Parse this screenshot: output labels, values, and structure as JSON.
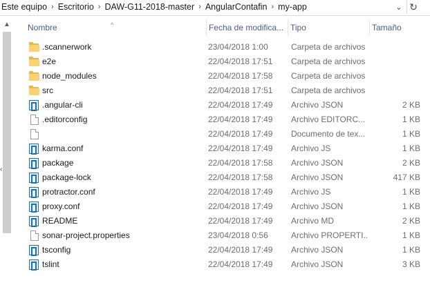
{
  "breadcrumb": [
    "Este equipo",
    "Escritorio",
    "DAW-G11-2018-master",
    "AngularContafin",
    "my-app"
  ],
  "columns": {
    "name": "Nombre",
    "date": "Fecha de modifica...",
    "type": "Tipo",
    "size": "Tamaño"
  },
  "files": [
    {
      "icon": "folder-icon",
      "name": ".scannerwork",
      "date": "23/04/2018 1:00",
      "type": "Carpeta de archivos",
      "size": ""
    },
    {
      "icon": "folder-icon",
      "name": "e2e",
      "date": "22/04/2018 17:51",
      "type": "Carpeta de archivos",
      "size": ""
    },
    {
      "icon": "folder-icon",
      "name": "node_modules",
      "date": "22/04/2018 17:58",
      "type": "Carpeta de archivos",
      "size": ""
    },
    {
      "icon": "folder-icon",
      "name": "src",
      "date": "22/04/2018 17:51",
      "type": "Carpeta de archivos",
      "size": ""
    },
    {
      "icon": "json-file-icon",
      "name": ".angular-cli",
      "date": "22/04/2018 17:49",
      "type": "Archivo JSON",
      "size": "2 KB"
    },
    {
      "icon": "blank-file-icon",
      "name": ".editorconfig",
      "date": "22/04/2018 17:49",
      "type": "Archivo EDITORC...",
      "size": "1 KB"
    },
    {
      "icon": "blank-file-icon",
      "name": "",
      "date": "22/04/2018 17:49",
      "type": "Documento de tex...",
      "size": "1 KB"
    },
    {
      "icon": "json-file-icon",
      "name": "karma.conf",
      "date": "22/04/2018 17:49",
      "type": "Archivo JS",
      "size": "1 KB"
    },
    {
      "icon": "json-file-icon",
      "name": "package",
      "date": "22/04/2018 17:58",
      "type": "Archivo JSON",
      "size": "2 KB"
    },
    {
      "icon": "json-file-icon",
      "name": "package-lock",
      "date": "22/04/2018 17:58",
      "type": "Archivo JSON",
      "size": "417 KB"
    },
    {
      "icon": "json-file-icon",
      "name": "protractor.conf",
      "date": "22/04/2018 17:49",
      "type": "Archivo JS",
      "size": "1 KB"
    },
    {
      "icon": "json-file-icon",
      "name": "proxy.conf",
      "date": "22/04/2018 17:49",
      "type": "Archivo JSON",
      "size": "1 KB"
    },
    {
      "icon": "json-file-icon",
      "name": "README",
      "date": "22/04/2018 17:49",
      "type": "Archivo MD",
      "size": "2 KB"
    },
    {
      "icon": "blank-file-icon",
      "name": "sonar-project.properties",
      "date": "23/04/2018 0:56",
      "type": "Archivo PROPERTI...",
      "size": "1 KB"
    },
    {
      "icon": "json-file-icon",
      "name": "tsconfig",
      "date": "22/04/2018 17:49",
      "type": "Archivo JSON",
      "size": "1 KB"
    },
    {
      "icon": "json-file-icon",
      "name": "tslint",
      "date": "22/04/2018 17:49",
      "type": "Archivo JSON",
      "size": "3 KB"
    }
  ],
  "icons": {
    "address_dropdown": "chevron-down-icon",
    "refresh": "refresh-icon",
    "breadcrumb_separator": "chevron-right-icon",
    "sort": "sort-up-icon"
  }
}
